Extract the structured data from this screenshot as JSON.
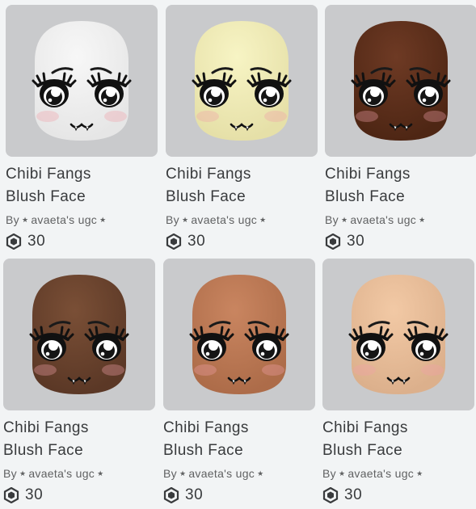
{
  "items": [
    {
      "name_line1": "Chibi Fangs",
      "name_line2": "Blush Face",
      "by": "By",
      "creator": "avaeta's ugc",
      "price": "30",
      "skin": "#f7f7f7",
      "shade": "#e6e6e6",
      "icon": "robux-icon"
    },
    {
      "name_line1": "Chibi Fangs",
      "name_line2": "Blush Face",
      "by": "By",
      "creator": "avaeta's ugc",
      "price": "30",
      "skin": "#f7f4c4",
      "shade": "#e6e0a8",
      "icon": "robux-icon"
    },
    {
      "name_line1": "Chibi Fangs",
      "name_line2": "Blush Face",
      "by": "By",
      "creator": "avaeta's ugc",
      "price": "30",
      "skin": "#6e3a24",
      "shade": "#4e2614",
      "icon": "robux-icon"
    },
    {
      "name_line1": "Chibi Fangs",
      "name_line2": "Blush Face",
      "by": "By",
      "creator": "avaeta's ugc",
      "price": "30",
      "skin": "#7a4f36",
      "shade": "#5b3826",
      "icon": "robux-icon"
    },
    {
      "name_line1": "Chibi Fangs",
      "name_line2": "Blush Face",
      "by": "By",
      "creator": "avaeta's ugc",
      "price": "30",
      "skin": "#c98560",
      "shade": "#ad6c49",
      "icon": "robux-icon"
    },
    {
      "name_line1": "Chibi Fangs",
      "name_line2": "Blush Face",
      "by": "By",
      "creator": "avaeta's ugc",
      "price": "30",
      "skin": "#f2c9a5",
      "shade": "#dcb08c",
      "icon": "robux-icon"
    }
  ]
}
